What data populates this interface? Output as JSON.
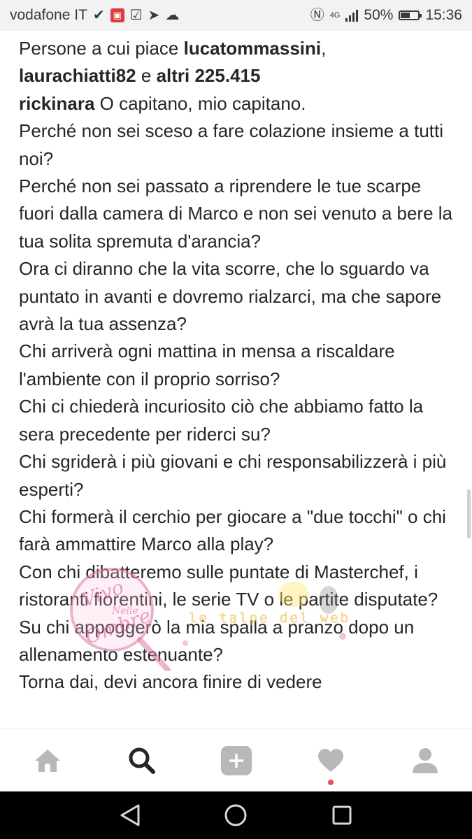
{
  "status_bar": {
    "carrier": "vodafone IT",
    "network_type": "4G",
    "battery_percent": "50%",
    "time": "15:36",
    "battery_level": 0.5
  },
  "post": {
    "likes": {
      "prefix": "Persone a cui piace ",
      "user1": "lucatommassini",
      "separator": ",",
      "user2": "laurachiatti82",
      "conjunction": " e ",
      "others": "altri 225.415"
    },
    "caption": {
      "username": "rickinara",
      "lines": [
        "O capitano, mio capitano.",
        "Perché non sei sceso a fare colazione insieme a tutti noi?",
        "Perché non sei passato a riprendere le tue scarpe fuori dalla camera di Marco e non sei venuto a bere la tua solita spremuta d'arancia?",
        "Ora ci diranno che la vita scorre, che lo sguardo va puntato in avanti e dovremo rialzarci, ma che sapore avrà la tua assenza?",
        "Chi arriverà ogni mattina in mensa a riscaldare l'ambiente con il proprio sorriso?",
        "Chi ci chiederà incuriosito ciò che abbiamo fatto la sera precedente per riderci su?",
        "Chi sgriderà i più giovani e chi responsabilizzerà i più esperti?",
        "Chi formerà il cerchio per giocare a \"due tocchi\" o chi farà ammattire Marco alla play?",
        "Con chi dibatteremo sulle puntate di Masterchef, i ristoranti fiorentini, le serie TV o le partite disputate?",
        "Su chi appoggerò la mia spalla a pranzo dopo un allenamento estenuante?",
        "Torna dai, devi ancora finire di vedere"
      ]
    }
  },
  "watermark": {
    "text1": "Vivo",
    "text2": "Nelle",
    "text3": "Ombre",
    "text4": "le talpe del web"
  },
  "tab_bar": {
    "items": [
      {
        "icon": "home-icon"
      },
      {
        "icon": "search-icon",
        "active": true
      },
      {
        "icon": "add-post-icon"
      },
      {
        "icon": "heart-icon",
        "has_notification": true
      },
      {
        "icon": "profile-icon"
      }
    ]
  },
  "nav_bar": {
    "items": [
      {
        "icon": "back-icon"
      },
      {
        "icon": "home-circle-icon"
      },
      {
        "icon": "recents-icon"
      }
    ]
  },
  "colors": {
    "notification_dot": "#ed4956",
    "status_bar_bg": "#f2f2f2",
    "nav_bar_bg": "#000000",
    "text": "#262626"
  }
}
